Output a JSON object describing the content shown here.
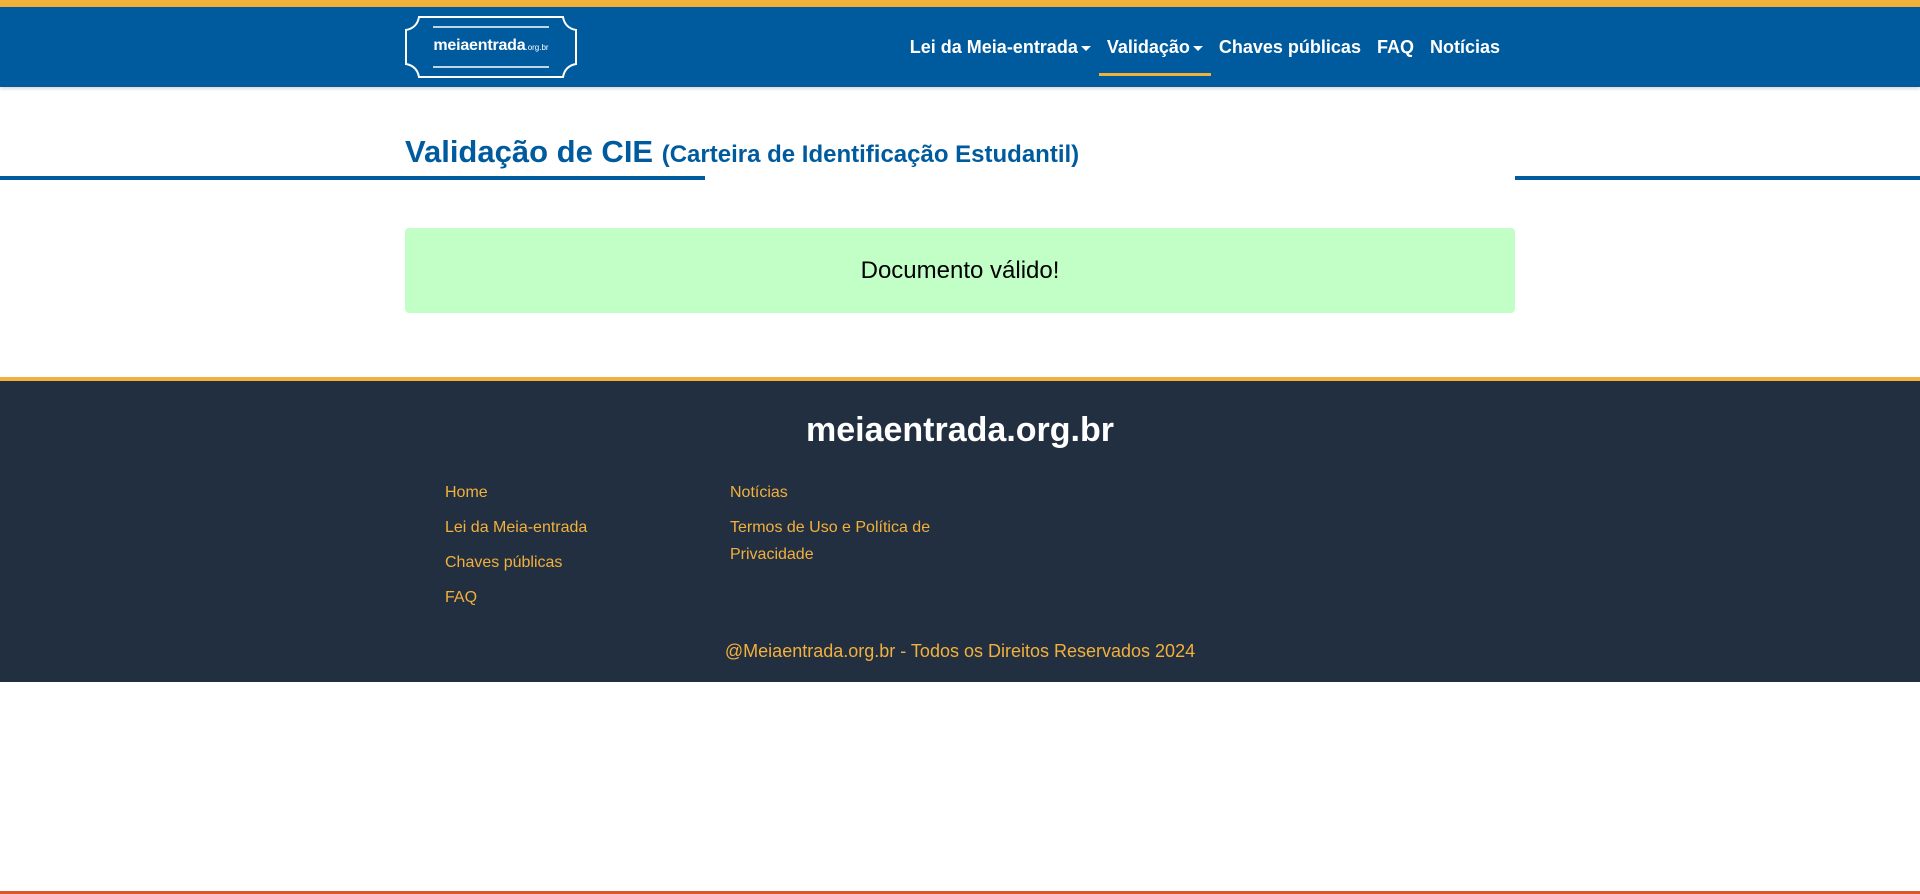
{
  "brand": {
    "logo_text": "meiaentrada",
    "logo_suffix": ".org.br"
  },
  "nav": {
    "items": [
      {
        "label": "Lei da Meia-entrada",
        "dropdown": true,
        "active": false
      },
      {
        "label": "Validação",
        "dropdown": true,
        "active": true
      },
      {
        "label": "Chaves públicas",
        "dropdown": false,
        "active": false
      },
      {
        "label": "FAQ",
        "dropdown": false,
        "active": false
      },
      {
        "label": "Notícias",
        "dropdown": false,
        "active": false
      }
    ]
  },
  "page": {
    "title": "Validação de CIE",
    "subtitle": "(Carteira de Identificação Estudantil)"
  },
  "alert": {
    "message": "Documento válido!"
  },
  "footer": {
    "title": "meiaentrada.org.br",
    "col1": [
      "Home",
      "Lei da Meia-entrada",
      "Chaves públicas",
      "FAQ"
    ],
    "col2": [
      "Notícias",
      "Termos de Uso e Política de Privacidade"
    ],
    "copyright": "@Meiaentrada.org.br - Todos os Direitos Reservados 2024"
  },
  "colors": {
    "primary": "#005b9e",
    "accent": "#f2b03c",
    "footer_bg": "#222f40",
    "success_bg": "#c1ffc6"
  }
}
